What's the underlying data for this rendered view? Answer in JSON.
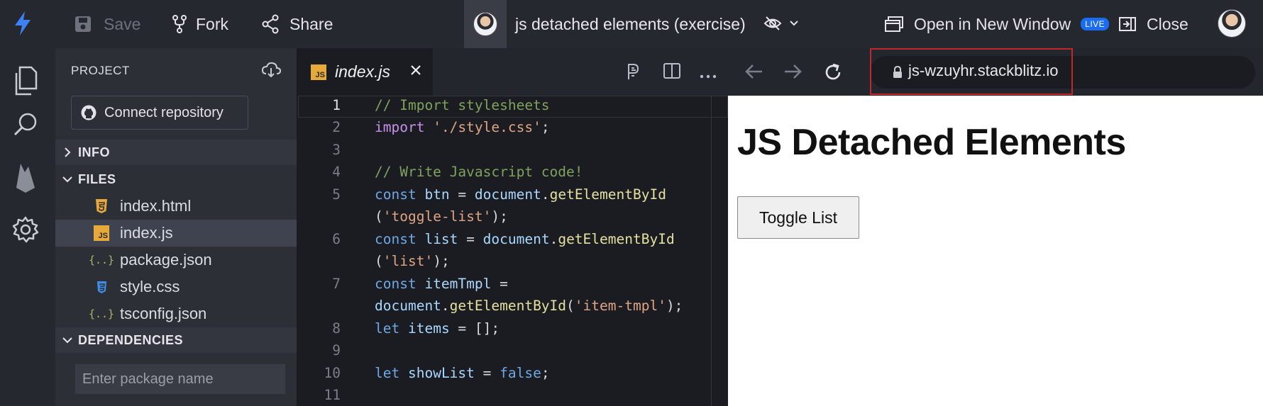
{
  "topbar": {
    "save_label": "Save",
    "fork_label": "Fork",
    "share_label": "Share",
    "project_title": "js detached elements (exercise)",
    "open_window_label": "Open in New Window",
    "live_badge": "LIVE",
    "close_label": "Close"
  },
  "activity_bar": {
    "icons": [
      "files-icon",
      "search-icon",
      "firebase-icon",
      "gear-icon"
    ]
  },
  "sidebar": {
    "project_label": "PROJECT",
    "connect_label": "Connect repository",
    "sections": {
      "info": "INFO",
      "files": "FILES",
      "dependencies": "DEPENDENCIES"
    },
    "files": [
      {
        "name": "index.html",
        "icon": "html-icon",
        "active": false
      },
      {
        "name": "index.js",
        "icon": "js-icon",
        "active": true
      },
      {
        "name": "package.json",
        "icon": "json-icon",
        "active": false
      },
      {
        "name": "style.css",
        "icon": "css-icon",
        "active": false
      },
      {
        "name": "tsconfig.json",
        "icon": "json-icon",
        "active": false
      }
    ],
    "package_placeholder": "Enter package name"
  },
  "editor": {
    "tab_label": "index.js",
    "js_badge": "JS",
    "line_numbers": [
      "1",
      "2",
      "3",
      "4",
      "5",
      "6",
      "7",
      "8",
      "9",
      "10",
      "11"
    ]
  },
  "preview": {
    "url": "js-wzuyhr.stackblitz.io",
    "heading": "JS Detached Elements",
    "toggle_button": "Toggle List"
  },
  "colors": {
    "accent": "#1a6df0",
    "url_highlight": "#c0282a",
    "js_badge": "#e8a93b"
  }
}
